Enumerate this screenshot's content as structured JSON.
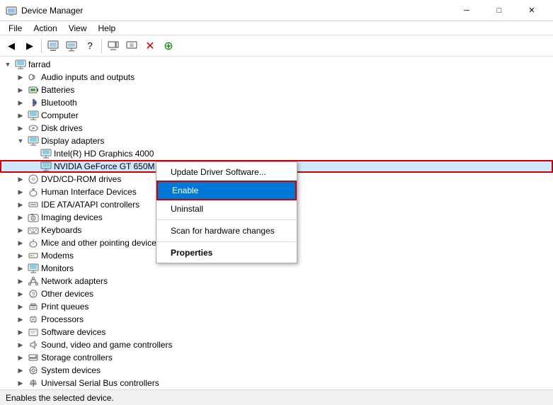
{
  "window": {
    "title": "Device Manager",
    "icon": "⚙"
  },
  "title_controls": {
    "minimize": "─",
    "maximize": "□",
    "close": "✕"
  },
  "menu": {
    "items": [
      "File",
      "Action",
      "View",
      "Help"
    ]
  },
  "toolbar": {
    "buttons": [
      "←",
      "→",
      "⊞",
      "⊡",
      "?",
      "⊟",
      "⊞",
      "❌",
      "⊕"
    ]
  },
  "tree": {
    "root": "farrad",
    "items": [
      {
        "level": 0,
        "label": "farrad",
        "icon": "🖥",
        "expanded": true,
        "type": "root"
      },
      {
        "level": 1,
        "label": "Audio inputs and outputs",
        "icon": "🔊",
        "expanded": false
      },
      {
        "level": 1,
        "label": "Batteries",
        "icon": "🔋",
        "expanded": false
      },
      {
        "level": 1,
        "label": "Bluetooth",
        "icon": "📶",
        "expanded": false
      },
      {
        "level": 1,
        "label": "Computer",
        "icon": "💻",
        "expanded": false
      },
      {
        "level": 1,
        "label": "Disk drives",
        "icon": "💿",
        "expanded": false
      },
      {
        "level": 1,
        "label": "Display adapters",
        "icon": "🖥",
        "expanded": true
      },
      {
        "level": 2,
        "label": "Intel(R) HD Graphics 4000",
        "icon": "🖥",
        "expanded": false
      },
      {
        "level": 2,
        "label": "NVIDIA GeForce GT 650M",
        "icon": "🖥",
        "expanded": false,
        "selected": true
      },
      {
        "level": 1,
        "label": "DVD/CD-ROM drives",
        "icon": "💿",
        "expanded": false
      },
      {
        "level": 1,
        "label": "Human Interface Devices",
        "icon": "🖱",
        "expanded": false
      },
      {
        "level": 1,
        "label": "IDE ATA/ATAPI controllers",
        "icon": "⚙",
        "expanded": false
      },
      {
        "level": 1,
        "label": "Imaging devices",
        "icon": "📷",
        "expanded": false
      },
      {
        "level": 1,
        "label": "Keyboards",
        "icon": "⌨",
        "expanded": false
      },
      {
        "level": 1,
        "label": "Mice and other pointing devices",
        "icon": "🖱",
        "expanded": false
      },
      {
        "level": 1,
        "label": "Modems",
        "icon": "📠",
        "expanded": false
      },
      {
        "level": 1,
        "label": "Monitors",
        "icon": "🖥",
        "expanded": false
      },
      {
        "level": 1,
        "label": "Network adapters",
        "icon": "🌐",
        "expanded": false
      },
      {
        "level": 1,
        "label": "Other devices",
        "icon": "❓",
        "expanded": false
      },
      {
        "level": 1,
        "label": "Print queues",
        "icon": "🖨",
        "expanded": false
      },
      {
        "level": 1,
        "label": "Processors",
        "icon": "⚙",
        "expanded": false
      },
      {
        "level": 1,
        "label": "Software devices",
        "icon": "💾",
        "expanded": false
      },
      {
        "level": 1,
        "label": "Sound, video and game controllers",
        "icon": "🎮",
        "expanded": false
      },
      {
        "level": 1,
        "label": "Storage controllers",
        "icon": "💾",
        "expanded": false
      },
      {
        "level": 1,
        "label": "System devices",
        "icon": "⚙",
        "expanded": false
      },
      {
        "level": 1,
        "label": "Universal Serial Bus controllers",
        "icon": "🔌",
        "expanded": false
      }
    ]
  },
  "context_menu": {
    "items": [
      {
        "label": "Update Driver Software...",
        "type": "normal"
      },
      {
        "label": "Enable",
        "type": "highlighted"
      },
      {
        "label": "Uninstall",
        "type": "normal"
      },
      {
        "separator": true
      },
      {
        "label": "Scan for hardware changes",
        "type": "normal"
      },
      {
        "separator": true
      },
      {
        "label": "Properties",
        "type": "bold"
      }
    ]
  },
  "status_bar": {
    "text": "Enables the selected device."
  }
}
